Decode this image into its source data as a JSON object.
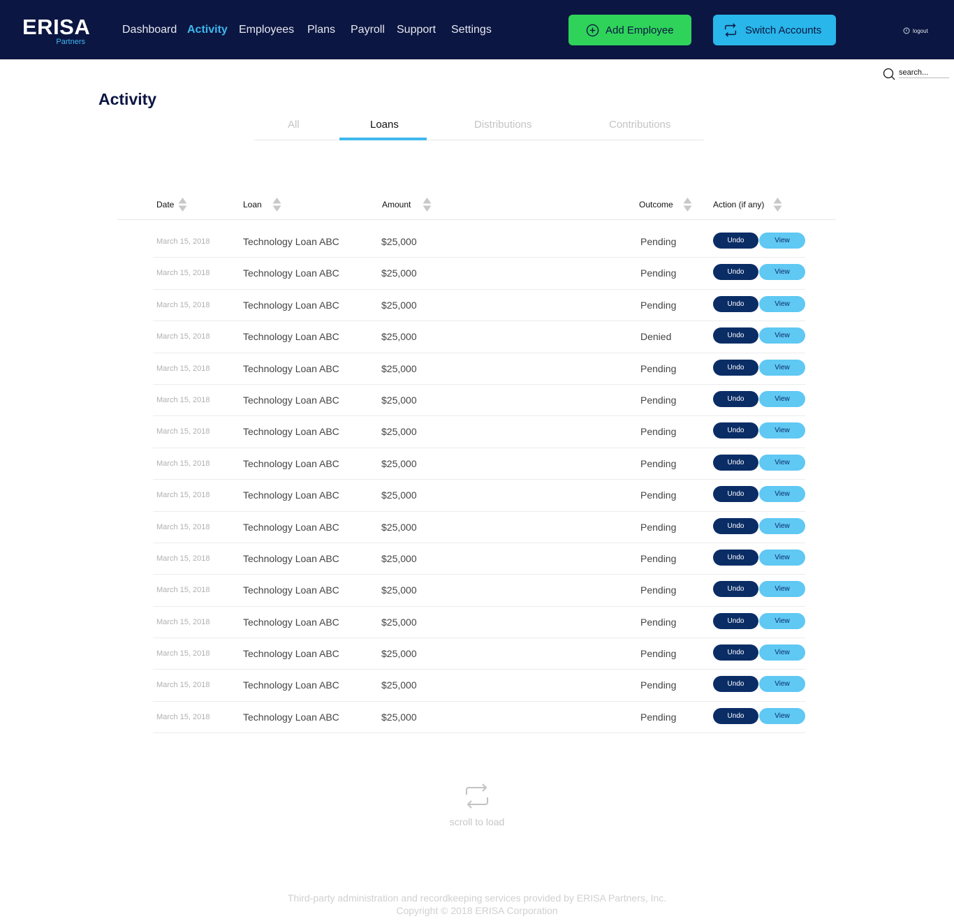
{
  "brand": {
    "name": "ERISA",
    "sub": "Partners"
  },
  "nav": {
    "items": [
      {
        "label": "Dashboard",
        "active": false
      },
      {
        "label": "Activity",
        "active": true
      },
      {
        "label": "Employees",
        "active": false
      },
      {
        "label": "Plans",
        "active": false
      },
      {
        "label": "Payroll",
        "active": false
      },
      {
        "label": "Support",
        "active": false
      },
      {
        "label": "Settings",
        "active": false
      }
    ]
  },
  "header": {
    "add_employee": {
      "label": "Add Employee",
      "icon": "plus-circle-icon",
      "color": "#2fd35a"
    },
    "switch_accounts": {
      "label": "Switch Accounts",
      "icon": "switch-arrows-icon",
      "color": "#29b6ea"
    },
    "logout": {
      "label": "logout",
      "icon": "power-icon"
    }
  },
  "search": {
    "placeholder": "search..."
  },
  "page": {
    "title": "Activity"
  },
  "tabs": [
    {
      "label": "All",
      "active": false
    },
    {
      "label": "Loans",
      "active": true
    },
    {
      "label": "Distributions",
      "active": false
    },
    {
      "label": "Contributions",
      "active": false
    }
  ],
  "table": {
    "columns": [
      "Date",
      "Loan",
      "Amount",
      "Outcome",
      "Action (if any)"
    ],
    "undo_label": "Undo",
    "view_label": "View",
    "rows": [
      {
        "date": "March 15, 2018",
        "loan": "Technology Loan ABC",
        "amount": "$25,000",
        "outcome": "Pending"
      },
      {
        "date": "March 15, 2018",
        "loan": "Technology Loan ABC",
        "amount": "$25,000",
        "outcome": "Pending"
      },
      {
        "date": "March 15, 2018",
        "loan": "Technology Loan ABC",
        "amount": "$25,000",
        "outcome": "Pending"
      },
      {
        "date": "March 15, 2018",
        "loan": "Technology Loan ABC",
        "amount": "$25,000",
        "outcome": "Denied"
      },
      {
        "date": "March 15, 2018",
        "loan": "Technology Loan ABC",
        "amount": "$25,000",
        "outcome": "Pending"
      },
      {
        "date": "March 15, 2018",
        "loan": "Technology Loan ABC",
        "amount": "$25,000",
        "outcome": "Pending"
      },
      {
        "date": "March 15, 2018",
        "loan": "Technology Loan ABC",
        "amount": "$25,000",
        "outcome": "Pending"
      },
      {
        "date": "March 15, 2018",
        "loan": "Technology Loan ABC",
        "amount": "$25,000",
        "outcome": "Pending"
      },
      {
        "date": "March 15, 2018",
        "loan": "Technology Loan ABC",
        "amount": "$25,000",
        "outcome": "Pending"
      },
      {
        "date": "March 15, 2018",
        "loan": "Technology Loan ABC",
        "amount": "$25,000",
        "outcome": "Pending"
      },
      {
        "date": "March 15, 2018",
        "loan": "Technology Loan ABC",
        "amount": "$25,000",
        "outcome": "Pending"
      },
      {
        "date": "March 15, 2018",
        "loan": "Technology Loan ABC",
        "amount": "$25,000",
        "outcome": "Pending"
      },
      {
        "date": "March 15, 2018",
        "loan": "Technology Loan ABC",
        "amount": "$25,000",
        "outcome": "Pending"
      },
      {
        "date": "March 15, 2018",
        "loan": "Technology Loan ABC",
        "amount": "$25,000",
        "outcome": "Pending"
      },
      {
        "date": "March 15, 2018",
        "loan": "Technology Loan ABC",
        "amount": "$25,000",
        "outcome": "Pending"
      },
      {
        "date": "March 15, 2018",
        "loan": "Technology Loan ABC",
        "amount": "$25,000",
        "outcome": "Pending"
      }
    ]
  },
  "load_more": {
    "label": "scroll to load",
    "icon": "repeat-arrows-icon"
  },
  "footer": {
    "line1": "Third-party administration and recordkeeping services provided by ERISA Partners, Inc.",
    "line2": "Copyright © 2018 ERISA Corporation"
  },
  "colors": {
    "navy": "#0b1642",
    "accent": "#3fb8ee",
    "undo": "#0b2d66",
    "view": "#5fc8f3"
  }
}
